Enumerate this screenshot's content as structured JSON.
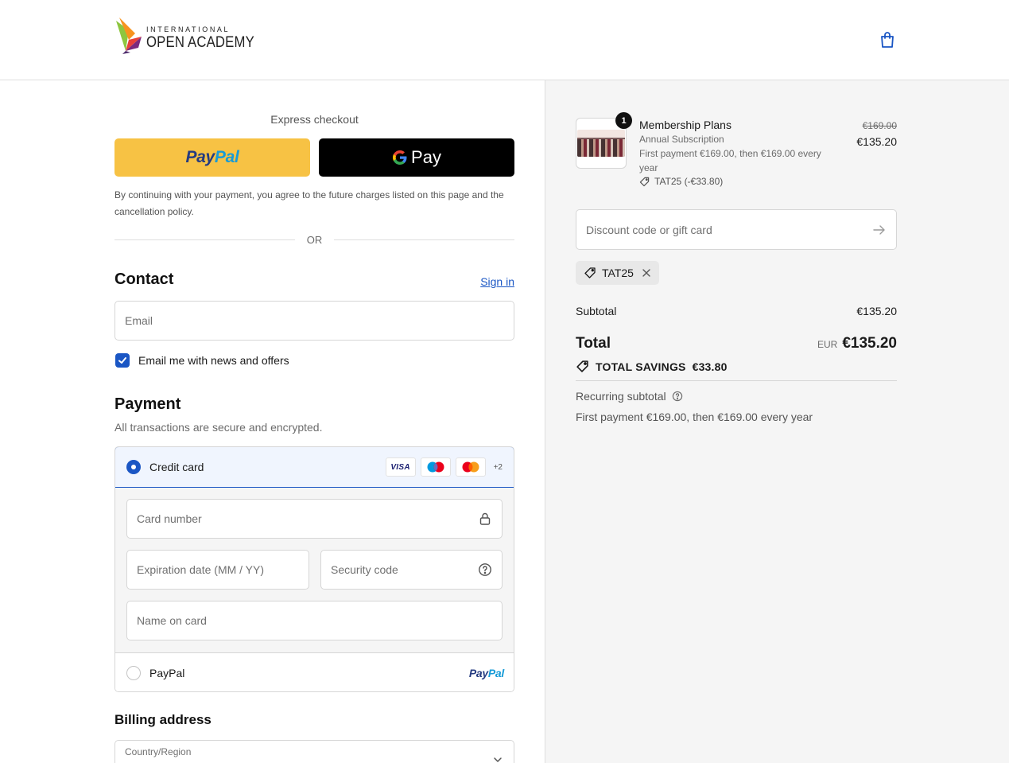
{
  "header": {
    "logo_small": "INTERNATIONAL",
    "logo_big": "OPEN ACADEMY"
  },
  "express": {
    "label": "Express checkout",
    "paypal_a": "Pay",
    "paypal_b": "Pal",
    "gpay_label": "Pay",
    "terms": "By continuing with your payment, you agree to the future charges listed on this page and the cancellation policy.",
    "or": "OR"
  },
  "contact": {
    "title": "Contact",
    "signin": "Sign in",
    "email_placeholder": "Email",
    "news_label": "Email me with news and offers",
    "news_checked": true
  },
  "payment": {
    "title": "Payment",
    "subtitle": "All transactions are secure and encrypted.",
    "credit_card_label": "Credit card",
    "card_brands": [
      "VISA",
      "maestro",
      "mastercard"
    ],
    "more_cards": "+2",
    "card_number_placeholder": "Card number",
    "expiry_placeholder": "Expiration date (MM / YY)",
    "security_placeholder": "Security code",
    "name_placeholder": "Name on card",
    "paypal_label": "PayPal",
    "paypal_logo_a": "Pay",
    "paypal_logo_b": "Pal"
  },
  "billing": {
    "title": "Billing address",
    "country_label": "Country/Region"
  },
  "summary": {
    "quantity": "1",
    "product_name": "Membership Plans",
    "product_variant": "Annual Subscription",
    "product_terms": "First payment €169.00, then €169.00 every year",
    "product_discount": "TAT25 (-€33.80)",
    "price_old": "€169.00",
    "price_new": "€135.20",
    "discount_placeholder": "Discount code or gift card",
    "applied_code": "TAT25",
    "subtotal_label": "Subtotal",
    "subtotal_value": "€135.20",
    "total_label": "Total",
    "currency": "EUR",
    "total_value": "€135.20",
    "savings_label": "TOTAL SAVINGS",
    "savings_value": "€33.80",
    "recurring_label": "Recurring subtotal",
    "recurring_line": "First payment €169.00, then €169.00 every year"
  },
  "colors": {
    "accent": "#1a56c4",
    "paypal_yellow": "#f7c244",
    "panel_bg": "#f5f5f5"
  }
}
